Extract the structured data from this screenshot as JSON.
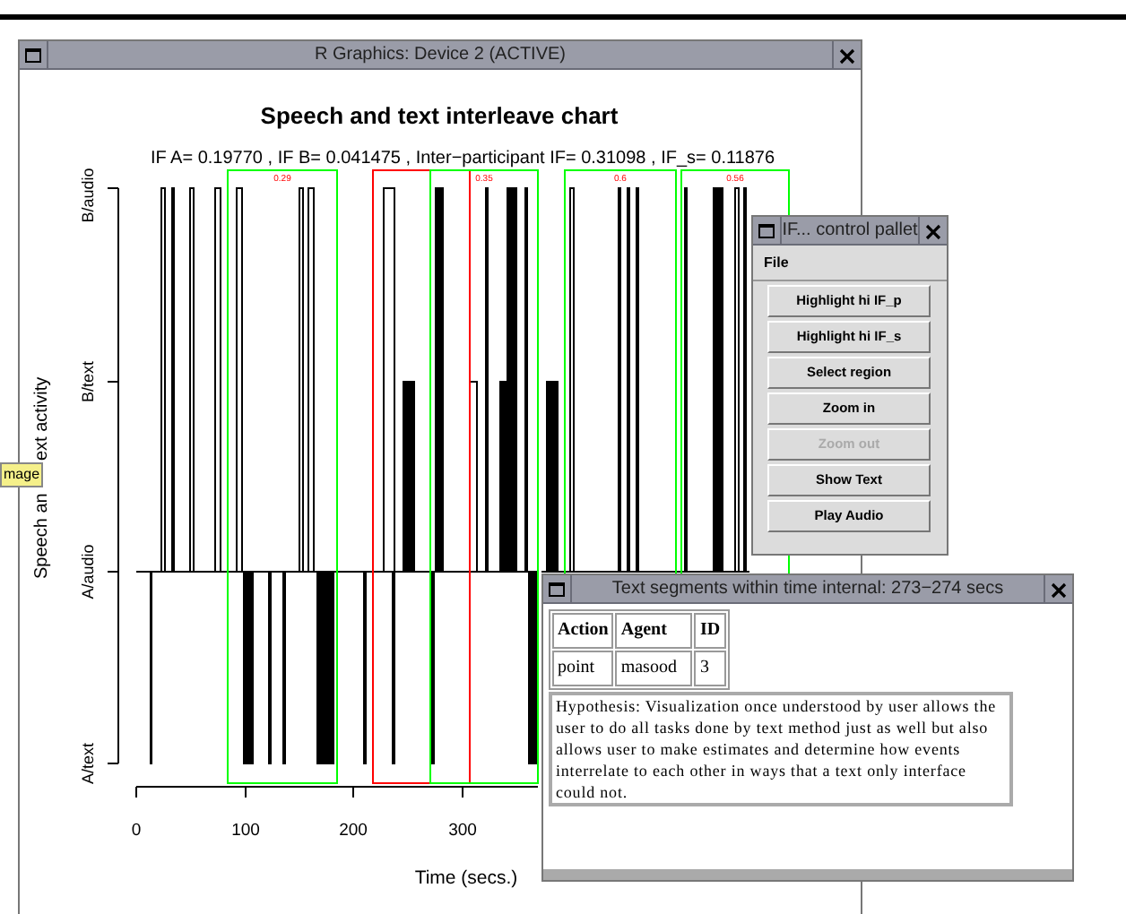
{
  "tooltip": {
    "text": "mage"
  },
  "main_window": {
    "title": "R Graphics: Device 2 (ACTIVE)",
    "plot": {
      "title": "Speech and text interleave chart",
      "subtitle": "IF A= 0.19770 , IF B= 0.041475 , Inter−participant IF= 0.31098 , IF_s= 0.11876",
      "ylabel_parts": [
        "Speech an",
        "ext activity"
      ],
      "xlabel": "Time (secs.)",
      "y_levels": [
        "B/audio",
        "B/text",
        "A/audio",
        "A/text"
      ],
      "x_ticks": [
        "0",
        "100",
        "200",
        "300"
      ],
      "regions": [
        {
          "label": "0.29",
          "color": "#00ff00"
        },
        {
          "color": "#ff0000"
        },
        {
          "label": "0.35",
          "color": "#00ff00"
        },
        {
          "label": "0.6",
          "color": "#00ff00"
        },
        {
          "label": "0.56",
          "color": "#00ff00"
        }
      ]
    }
  },
  "control_pallet": {
    "title": "IF... control pallet",
    "menu": [
      "File"
    ],
    "buttons": [
      {
        "label": "Highlight hi IF_p",
        "disabled": false
      },
      {
        "label": "Highlight hi IF_s",
        "disabled": false
      },
      {
        "label": "Select region",
        "disabled": false
      },
      {
        "label": "Zoom in",
        "disabled": false
      },
      {
        "label": "Zoom out",
        "disabled": true
      },
      {
        "label": "Show Text",
        "disabled": false
      },
      {
        "label": "Play Audio",
        "disabled": false
      }
    ]
  },
  "text_window": {
    "title": "Text segments within time internal: 273−274 secs",
    "table": {
      "columns": [
        "Action",
        "Agent",
        "ID"
      ],
      "rows": [
        [
          "point",
          "masood",
          "3"
        ]
      ]
    },
    "note": "Hypothesis: Visualization once understood by user allows the user to do all tasks done by text method just as well but also allows user to make estimates and determine how events interrelate to each other in ways that a text only interface could not."
  }
}
